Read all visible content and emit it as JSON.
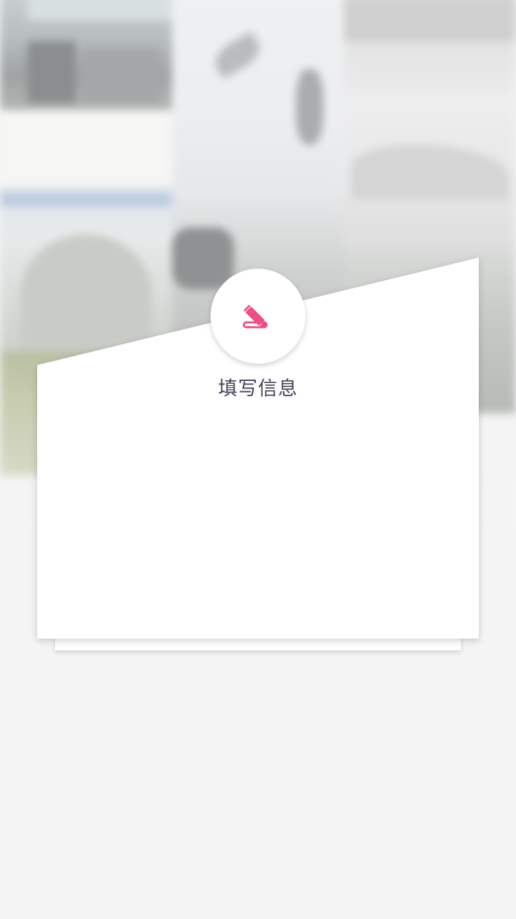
{
  "form_card": {
    "title": "填写信息",
    "icon": "pencil-write-icon",
    "accent_color": "#ec4f80"
  },
  "colors": {
    "page_background": "#f4f4f4",
    "card_background": "#ffffff",
    "title_text": "#45455a"
  }
}
